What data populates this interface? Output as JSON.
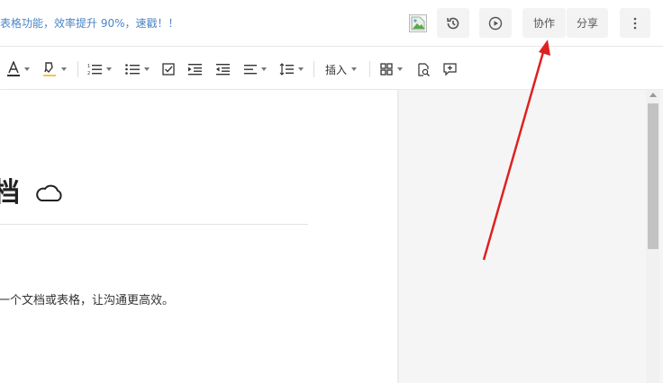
{
  "header": {
    "promo_text": "表格功能，效率提升 90%，速戳！！",
    "history_icon": "history-icon",
    "present_icon": "play-circle-icon",
    "collab_label": "协作",
    "share_label": "分享",
    "more_icon": "more-vertical-icon"
  },
  "toolbar": {
    "items": [
      "font-color-icon",
      "highlight-icon",
      "ordered-list-icon",
      "bullet-list-icon",
      "checklist-icon",
      "indent-icon",
      "outdent-icon",
      "align-icon",
      "line-height-icon",
      "insert",
      "table-icon",
      "find-icon",
      "comment-icon"
    ],
    "insert_label": "插入"
  },
  "document": {
    "title": "档",
    "body": "一个文档或表格，让沟通更高效。"
  },
  "colors": {
    "promo": "#4a86c5",
    "arrow": "#e02020",
    "highlight_underline": "#f5c542"
  }
}
